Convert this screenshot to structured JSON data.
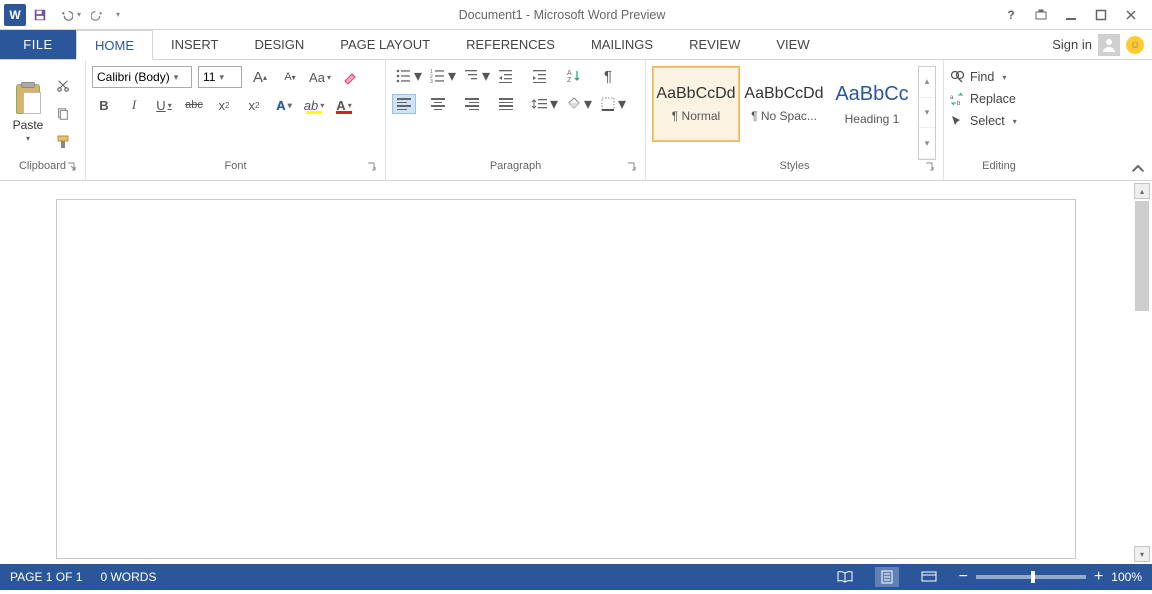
{
  "title": "Document1 - Microsoft Word Preview",
  "qat": {
    "word": "W"
  },
  "tabs": {
    "file": "FILE",
    "items": [
      "HOME",
      "INSERT",
      "DESIGN",
      "PAGE LAYOUT",
      "REFERENCES",
      "MAILINGS",
      "REVIEW",
      "VIEW"
    ],
    "active": 0,
    "signin": "Sign in"
  },
  "ribbon": {
    "clipboard": {
      "paste": "Paste",
      "label": "Clipboard"
    },
    "font": {
      "name": "Calibri (Body)",
      "size": "11",
      "label": "Font"
    },
    "paragraph": {
      "label": "Paragraph"
    },
    "styles": {
      "label": "Styles",
      "items": [
        {
          "preview": "AaBbCcDd",
          "name": "¶ Normal"
        },
        {
          "preview": "AaBbCcDd",
          "name": "¶ No Spac..."
        },
        {
          "preview": "AaBbCc",
          "name": "Heading 1"
        }
      ]
    },
    "editing": {
      "label": "Editing",
      "find": "Find",
      "replace": "Replace",
      "select": "Select"
    }
  },
  "status": {
    "page": "PAGE 1 OF 1",
    "words": "0 WORDS",
    "zoom": "100%"
  }
}
